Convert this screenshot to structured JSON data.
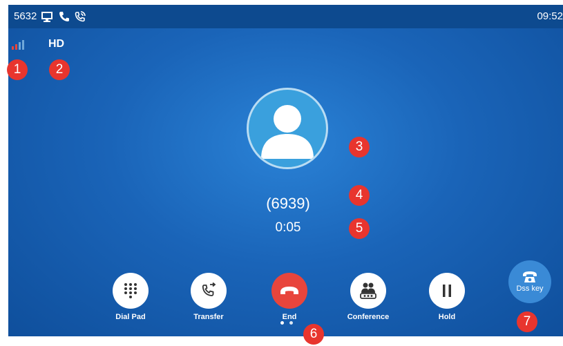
{
  "status_bar": {
    "extension": "5632",
    "time": "09:52"
  },
  "call_info": {
    "quality": "HD",
    "number": "(6939)",
    "duration": "0:05"
  },
  "buttons": {
    "dial_pad": "Dial Pad",
    "transfer": "Transfer",
    "end": "End",
    "conference": "Conference",
    "hold": "Hold",
    "dss_key": "Dss key"
  },
  "callouts": [
    "1",
    "2",
    "3",
    "4",
    "5",
    "6",
    "7"
  ],
  "colors": {
    "accent_red": "#e8453c",
    "badge_red": "#e8352e",
    "status_bar": "#0d4a8f"
  },
  "icons": [
    "signal-icon",
    "computer-icon",
    "phone-icon",
    "call-active-icon",
    "contact-avatar-icon",
    "dialpad-icon",
    "transfer-icon",
    "end-call-icon",
    "conference-icon",
    "hold-icon",
    "dss-phone-icon"
  ]
}
